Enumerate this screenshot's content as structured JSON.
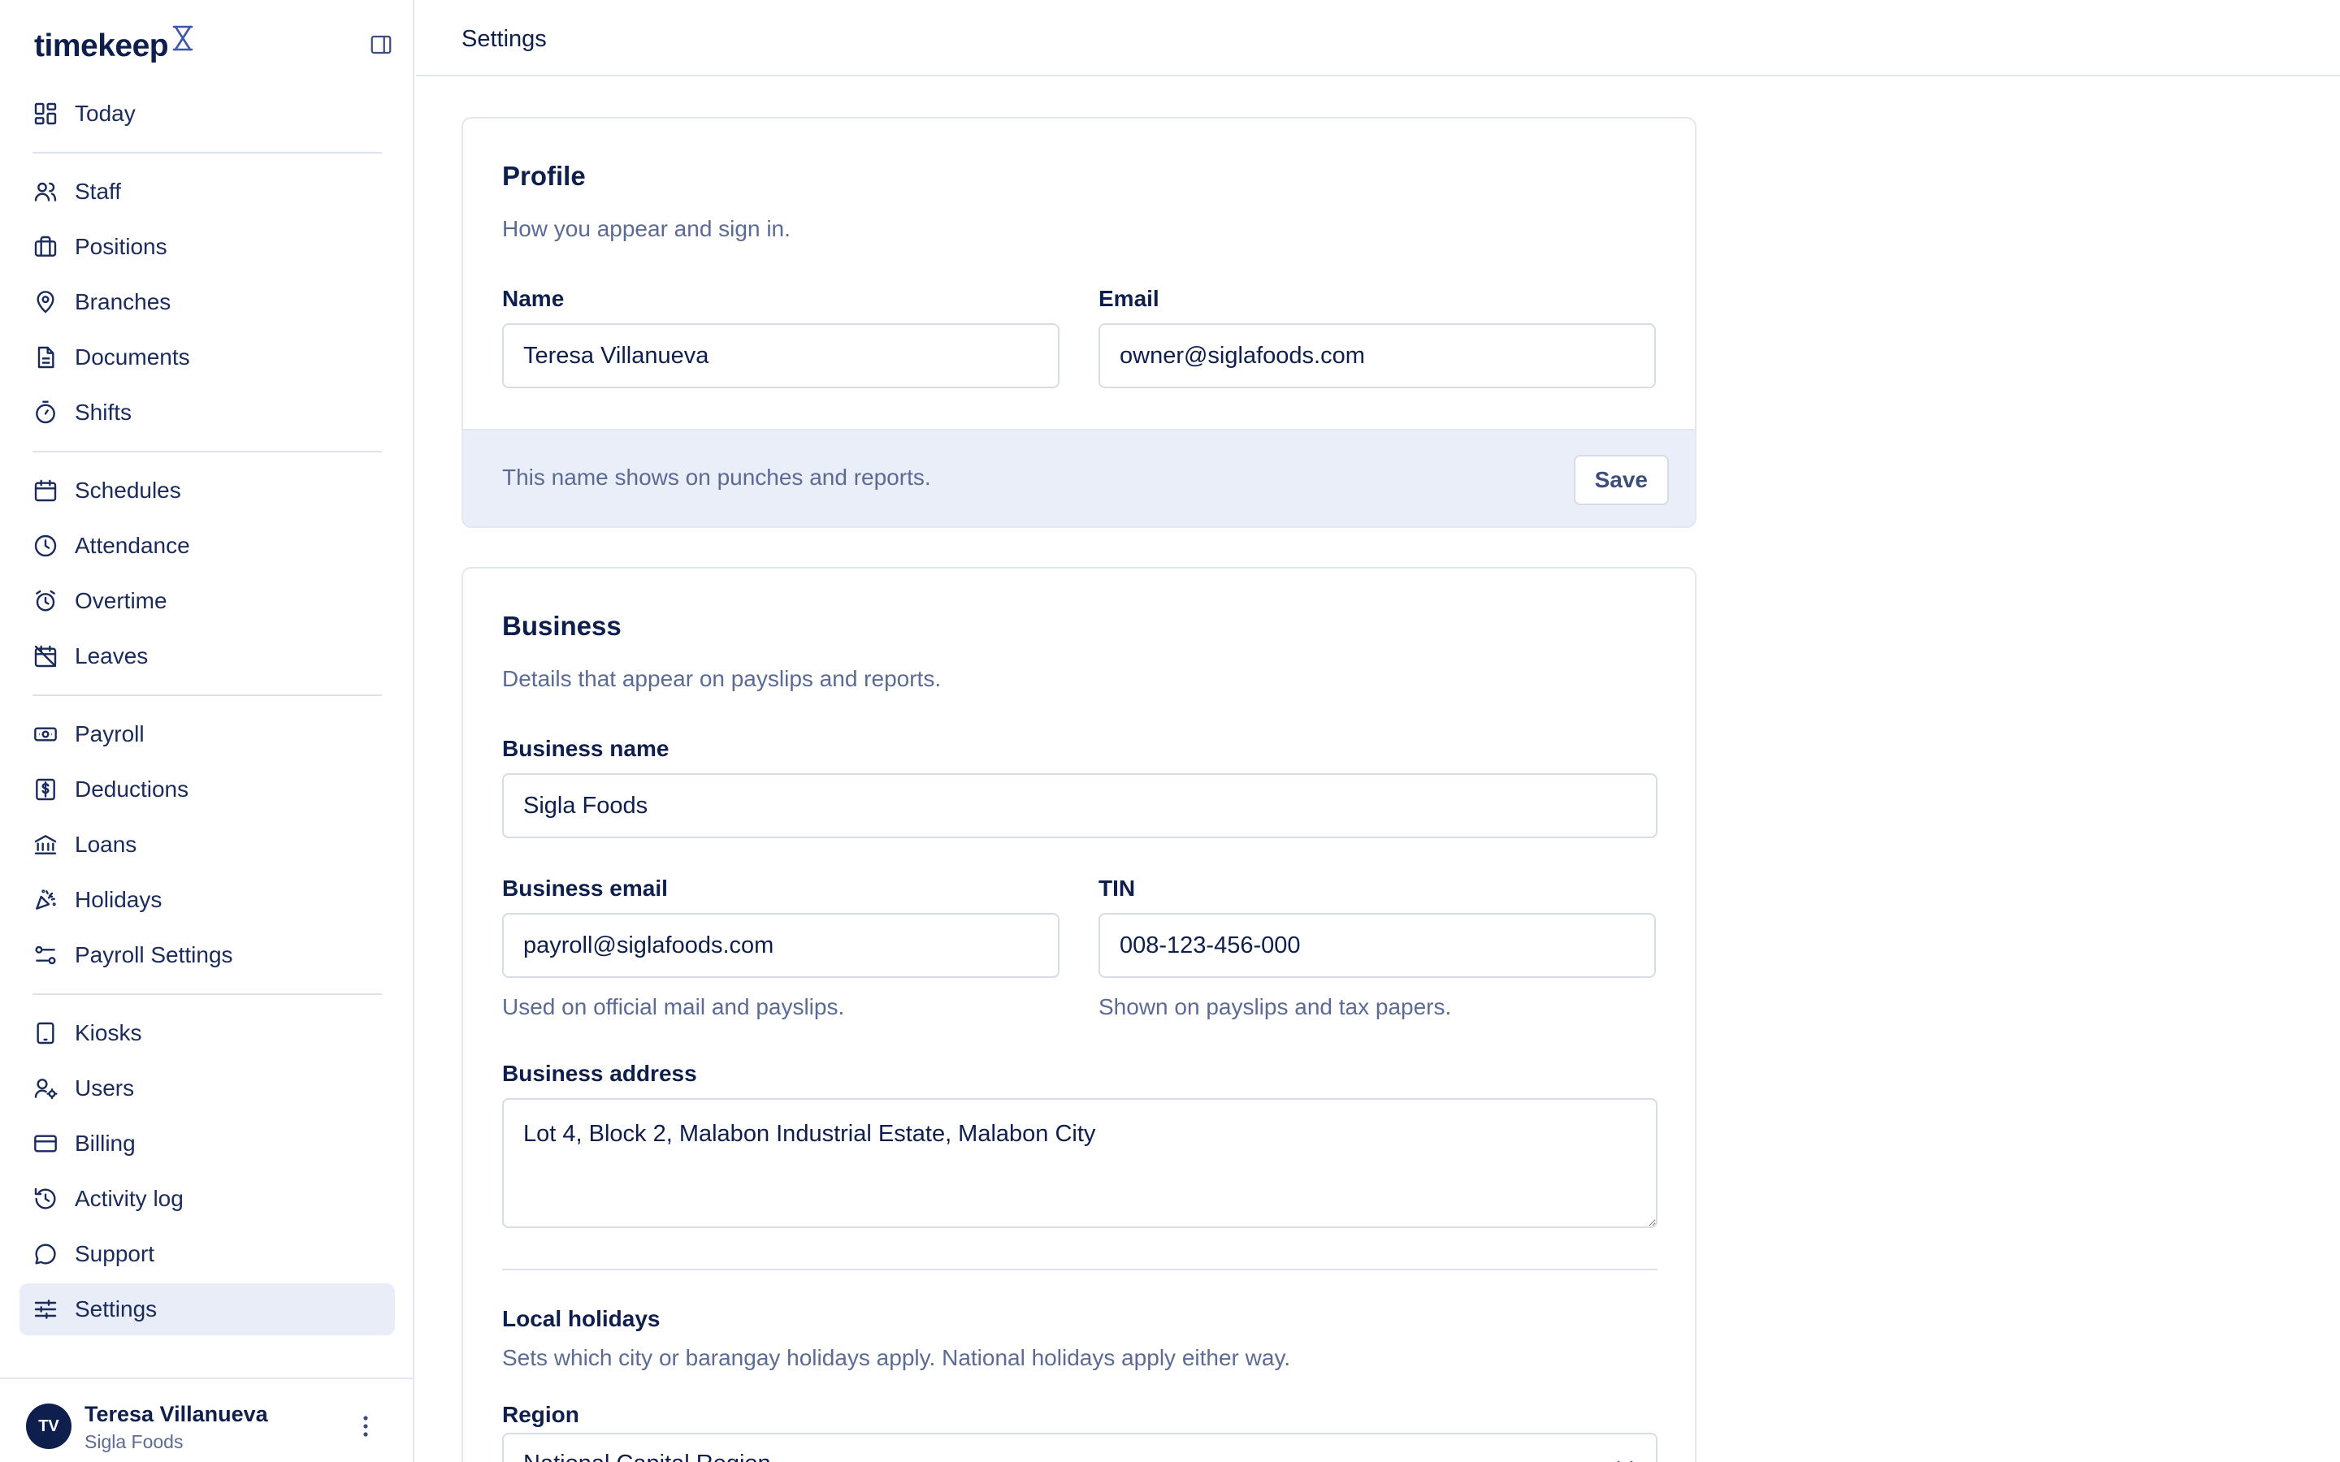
{
  "app": {
    "brand": "timekeep",
    "page_title": "Settings"
  },
  "sidebar": {
    "items": [
      {
        "label": "Today",
        "icon": "dashboard-icon",
        "active": false
      },
      {
        "label": "Staff",
        "icon": "users-icon",
        "active": false
      },
      {
        "label": "Positions",
        "icon": "briefcase-icon",
        "active": false
      },
      {
        "label": "Branches",
        "icon": "map-pin-icon",
        "active": false
      },
      {
        "label": "Documents",
        "icon": "document-icon",
        "active": false
      },
      {
        "label": "Shifts",
        "icon": "stopwatch-icon",
        "active": false
      },
      {
        "label": "Schedules",
        "icon": "calendar-icon",
        "active": false
      },
      {
        "label": "Attendance",
        "icon": "clock-icon",
        "active": false
      },
      {
        "label": "Overtime",
        "icon": "alarm-clock-icon",
        "active": false
      },
      {
        "label": "Leaves",
        "icon": "calendar-off-icon",
        "active": false
      },
      {
        "label": "Payroll",
        "icon": "banknote-icon",
        "active": false
      },
      {
        "label": "Deductions",
        "icon": "receipt-dollar-icon",
        "active": false
      },
      {
        "label": "Loans",
        "icon": "bank-icon",
        "active": false
      },
      {
        "label": "Holidays",
        "icon": "party-popper-icon",
        "active": false
      },
      {
        "label": "Payroll Settings",
        "icon": "settings-sliders-icon",
        "active": false
      },
      {
        "label": "Kiosks",
        "icon": "tablet-icon",
        "active": false
      },
      {
        "label": "Users",
        "icon": "user-gear-icon",
        "active": false
      },
      {
        "label": "Billing",
        "icon": "credit-card-icon",
        "active": false
      },
      {
        "label": "Activity log",
        "icon": "history-icon",
        "active": false
      },
      {
        "label": "Support",
        "icon": "chat-bubble-icon",
        "active": false
      },
      {
        "label": "Settings",
        "icon": "sliders-icon",
        "active": true
      }
    ],
    "user": {
      "initials": "TV",
      "name": "Teresa Villanueva",
      "org": "Sigla Foods"
    }
  },
  "profile": {
    "title": "Profile",
    "subtitle": "How you appear and sign in.",
    "name_label": "Name",
    "name_value": "Teresa Villanueva",
    "email_label": "Email",
    "email_value": "owner@siglafoods.com",
    "footer_text": "This name shows on punches and reports.",
    "save_label": "Save"
  },
  "business": {
    "title": "Business",
    "subtitle": "Details that appear on payslips and reports.",
    "name_label": "Business name",
    "name_value": "Sigla Foods",
    "email_label": "Business email",
    "email_value": "payroll@siglafoods.com",
    "email_hint": "Used on official mail and payslips.",
    "tin_label": "TIN",
    "tin_value": "008-123-456-000",
    "tin_hint": "Shown on payslips and tax papers.",
    "address_label": "Business address",
    "address_value": "Lot 4, Block 2, Malabon Industrial Estate, Malabon City",
    "local_holidays_title": "Local holidays",
    "local_holidays_subtitle": "Sets which city or barangay holidays apply. National holidays apply either way.",
    "region_label": "Region",
    "region_value": "National Capital Region"
  },
  "colors": {
    "primary": "#0f1f4d",
    "muted": "#5b6b94",
    "active_bg": "#e8edf8",
    "footer_bg": "#e9eef9",
    "border": "#d6dce8"
  }
}
